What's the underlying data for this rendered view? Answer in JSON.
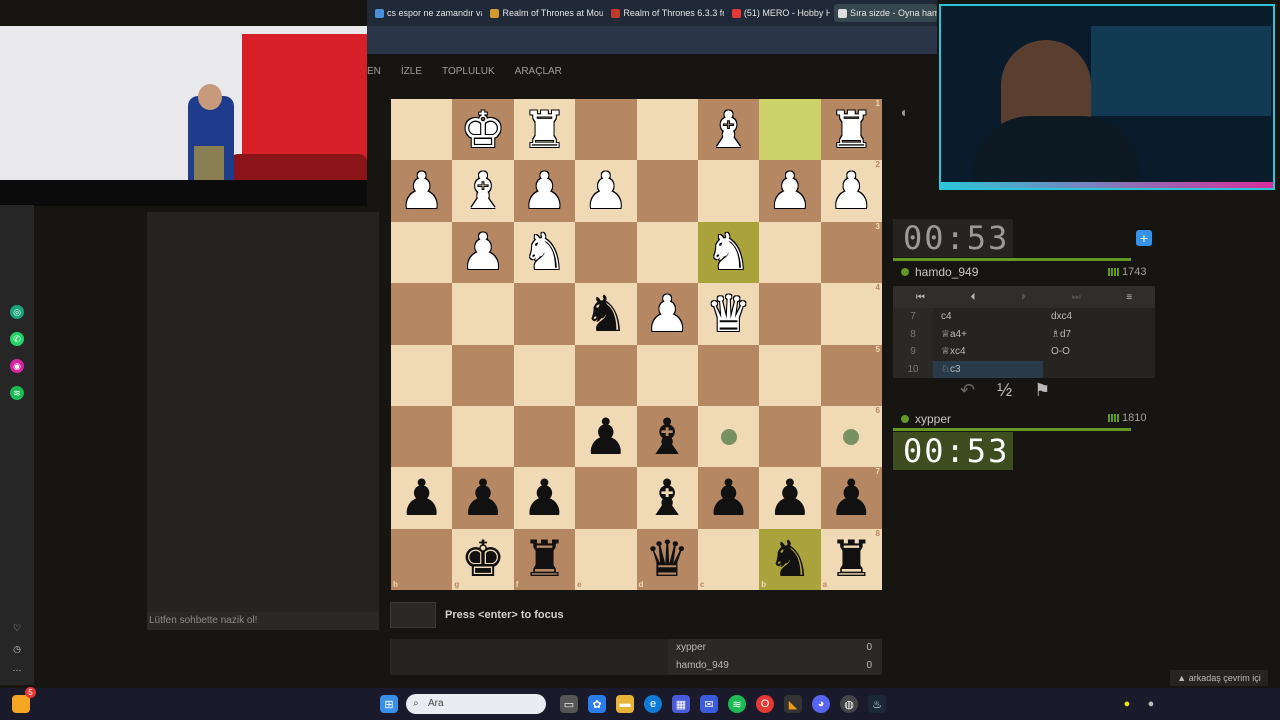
{
  "browser_tabs": [
    {
      "label": "cs espor ne zamandır va",
      "color": "#4a90d9"
    },
    {
      "label": "Realm of Thrones at Mour",
      "color": "#d49a2a"
    },
    {
      "label": "Realm of Thrones 6.3.3 fo",
      "color": "#c0392b"
    },
    {
      "label": "(51) MERO - Hobby H",
      "color": "#e53935"
    },
    {
      "label": "Sıra sizde - Oyna ham",
      "color": "#dddddd"
    }
  ],
  "nav": {
    "items": [
      "EN",
      "İZLE",
      "TOPLULUK",
      "ARAÇLAR"
    ]
  },
  "chat": {
    "placeholder": "Lütfen sohbette nazik ol!"
  },
  "board": {
    "orientation": "black",
    "ranks": [
      [
        "",
        "wK",
        "wR",
        "",
        "",
        "wB",
        "",
        "wR"
      ],
      [
        "wP",
        "wB",
        "wP",
        "wP",
        "",
        "",
        "wP",
        "wP"
      ],
      [
        "",
        "wP",
        "wN",
        "",
        "",
        "wN",
        "",
        ""
      ],
      [
        "",
        "",
        "",
        "bN",
        "wP",
        "wQ",
        "",
        ""
      ],
      [
        "",
        "",
        "",
        "",
        "",
        "",
        "",
        ""
      ],
      [
        "",
        "",
        "",
        "bP",
        "bB",
        "dot",
        "",
        "dot"
      ],
      [
        "bP",
        "bP",
        "bP",
        "",
        "bB",
        "bP",
        "bP",
        "bP"
      ],
      [
        "",
        "bK",
        "bR",
        "",
        "bQ",
        "",
        "bN",
        "bR"
      ]
    ],
    "highlights": [
      [
        0,
        6
      ],
      [
        2,
        5
      ],
      [
        7,
        6
      ]
    ],
    "rank_labels": [
      "1",
      "2",
      "3",
      "4",
      "5",
      "6",
      "7",
      "8"
    ],
    "file_labels": [
      "h",
      "g",
      "f",
      "e",
      "d",
      "c",
      "b",
      "a"
    ]
  },
  "players": {
    "top": {
      "name": "hamdo_949",
      "rating": "1743",
      "clock": "00:53"
    },
    "bottom": {
      "name": "xypper",
      "rating": "1810",
      "clock": "00:53"
    }
  },
  "moves": [
    {
      "num": "7",
      "white": "c4",
      "black": "dxc4"
    },
    {
      "num": "8",
      "white": "♕a4+",
      "black": "♗d7"
    },
    {
      "num": "9",
      "white": "♕xc4",
      "black": "O-O"
    },
    {
      "num": "10",
      "white": "♘c3",
      "black": ""
    }
  ],
  "move_controls": [
    "⏮",
    "⏴",
    "⏵",
    "⏭",
    "≡"
  ],
  "actions": {
    "takeback": "↶",
    "draw": "½",
    "resign": "⚑"
  },
  "focus_hint": "Press <enter> to focus",
  "score": [
    {
      "name": "xypper",
      "value": "0"
    },
    {
      "name": "hamdo_949",
      "value": "0"
    }
  ],
  "friends": "▲ arkadaş çevrim içi",
  "taskbar": {
    "search_placeholder": "Ara",
    "badge": "5"
  }
}
